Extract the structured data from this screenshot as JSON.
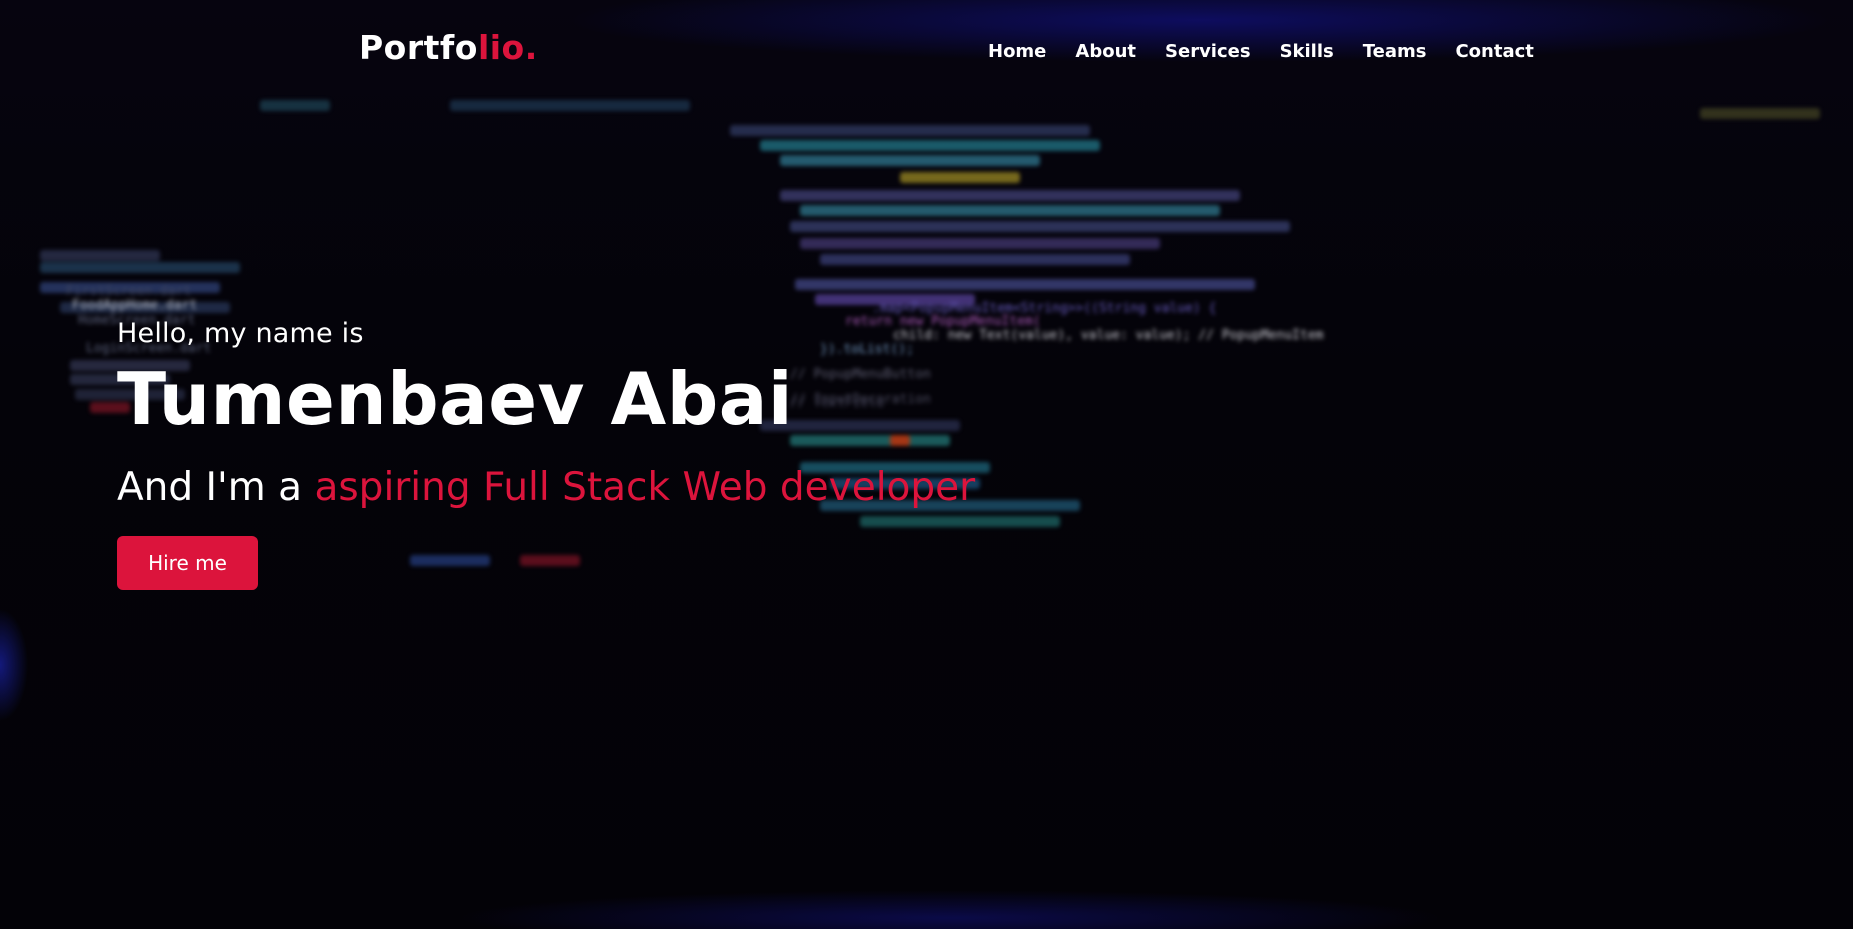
{
  "brand": {
    "logo_main": "Portfo",
    "logo_accent": "lio.",
    "accent_color": "#dc143c"
  },
  "nav": {
    "items": [
      {
        "label": "Home"
      },
      {
        "label": "About"
      },
      {
        "label": "Services"
      },
      {
        "label": "Skills"
      },
      {
        "label": "Teams"
      },
      {
        "label": "Contact"
      }
    ]
  },
  "hero": {
    "greeting": "Hello, my name is",
    "name": "Tumenbaev Abai",
    "role_prefix": "And I'm a ",
    "role_highlight": "aspiring Full Stack Web developer",
    "cta_label": "Hire me"
  },
  "background_code": {
    "lines": [
      "child: new Text(value), value: value); // PopupMenuItem",
      "return new PopupMenuItem(",
      ".map<PopupMenuItem<String>>((String value) {",
      "}).toList();",
      "// PopupMenuButton",
      "// InputDecoration",
      "// TextField",
      "FoodAppHome.dart",
      "HomeScreen.dart",
      "LoginScreen.dart",
      "FirstScreen.dart"
    ]
  }
}
